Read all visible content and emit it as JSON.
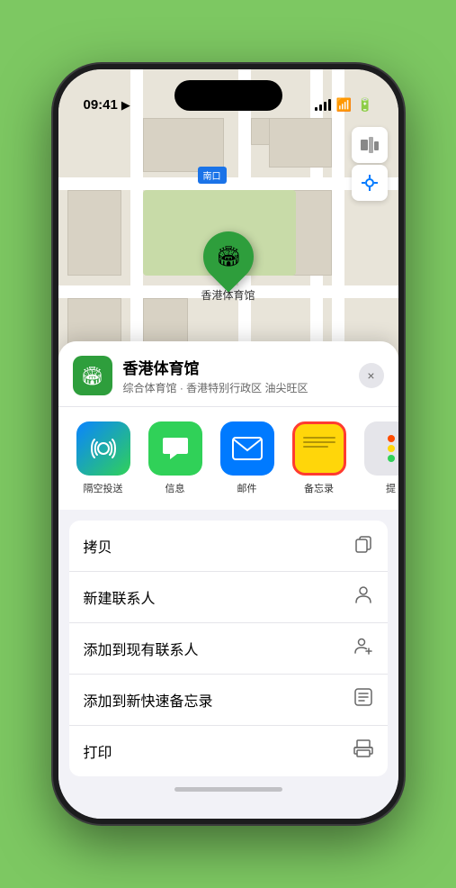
{
  "status_bar": {
    "time": "09:41",
    "location_icon": "▶"
  },
  "map": {
    "label_text": "南口",
    "venue_name": "香港体育馆",
    "venue_type": "综合体育馆 · 香港特别行政区 油尖旺区"
  },
  "controls": {
    "map_icon": "🗺",
    "location_icon": "◎"
  },
  "share_items": [
    {
      "id": "airdrop",
      "label": "隔空投送"
    },
    {
      "id": "messages",
      "label": "信息"
    },
    {
      "id": "mail",
      "label": "邮件"
    },
    {
      "id": "notes",
      "label": "备忘录"
    },
    {
      "id": "more",
      "label": "提"
    }
  ],
  "actions": [
    {
      "label": "拷贝",
      "icon": "copy"
    },
    {
      "label": "新建联系人",
      "icon": "person"
    },
    {
      "label": "添加到现有联系人",
      "icon": "person-add"
    },
    {
      "label": "添加到新快速备忘录",
      "icon": "note"
    },
    {
      "label": "打印",
      "icon": "print"
    }
  ],
  "close_label": "×"
}
